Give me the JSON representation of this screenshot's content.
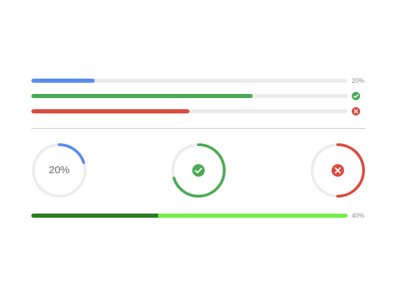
{
  "colors": {
    "track": "#ececec",
    "blue": "#5b8def",
    "green": "#4caa56",
    "red": "#db4c3f",
    "success_dark": "#2f7a22",
    "success_light": "#72f04a"
  },
  "line_progress": {
    "normal": {
      "percent": 20,
      "label": "20%"
    },
    "success": {
      "percent": 70,
      "icon": "check-circle-icon"
    },
    "exception": {
      "percent": 50,
      "icon": "close-circle-icon"
    }
  },
  "circle_progress": {
    "normal": {
      "percent": 20,
      "label": "20%"
    },
    "success": {
      "percent": 70,
      "icon": "check-icon"
    },
    "exception": {
      "percent": 50,
      "icon": "close-icon"
    }
  },
  "success_progress": {
    "percent": 40,
    "success_percent": 40,
    "label": "40%"
  }
}
